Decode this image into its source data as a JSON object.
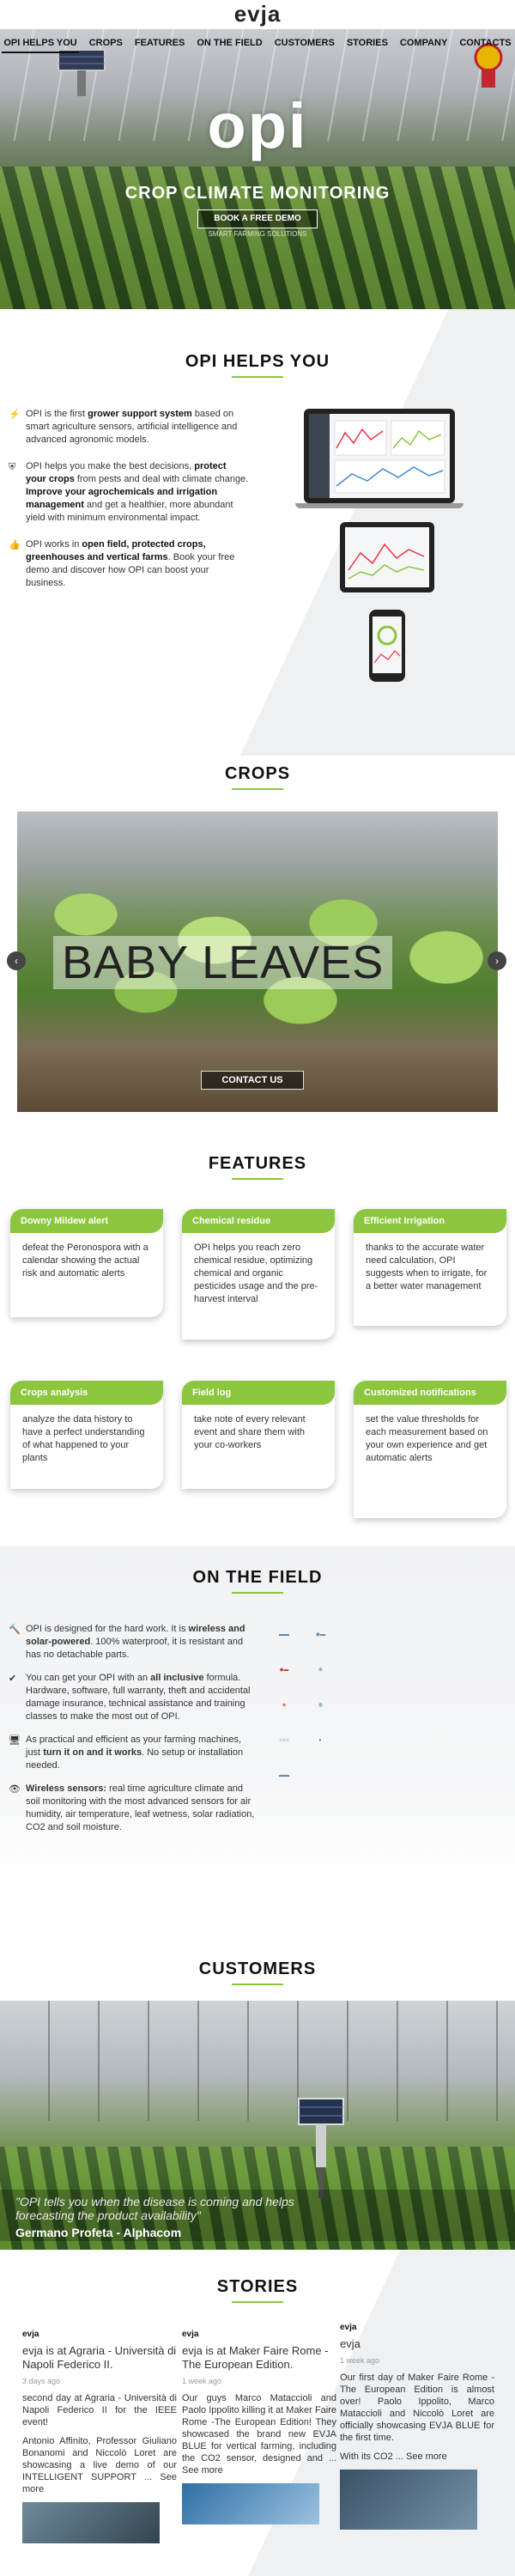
{
  "site": {
    "logo": "evja",
    "brand_mark": "opi"
  },
  "nav": [
    "OPI HELPS YOU",
    "CROPS",
    "FEATURES",
    "ON THE FIELD",
    "CUSTOMERS",
    "STORIES",
    "COMPANY",
    "CONTACTS"
  ],
  "hero": {
    "title": "CROP CLIMATE MONITORING",
    "cta": "BOOK A FREE DEMO",
    "tagline": "SMART FARMING SOLUTIONS"
  },
  "help": {
    "title": "OPI HELPS YOU",
    "items": [
      {
        "icon": "bolt-icon",
        "parts": [
          "OPI is the first ",
          "grower support system",
          " based on smart agriculture sensors, artificial intelligence and advanced agronomic models."
        ]
      },
      {
        "icon": "shield-icon",
        "parts": [
          "OPI helps you make the best decisions, ",
          "protect your crops",
          " from pests  and deal with climate change. ",
          "Improve your agrochemicals and irrigation management",
          " and get a healthier, more abundant yield with minimum environmental impact."
        ]
      },
      {
        "icon": "thumbs-up-icon",
        "parts": [
          "OPI works in ",
          "open field, protected crops, greenhouses and vertical farms",
          ". Book your free demo and discover how OPI can boost your business."
        ]
      }
    ]
  },
  "crops": {
    "title": "CROPS",
    "slide_label": "BABY LEAVES",
    "cta": "CONTACT US",
    "prev": "‹",
    "next": "›"
  },
  "features": {
    "title": "FEATURES",
    "cards": [
      {
        "title": "Downy Mildew alert",
        "text": "defeat the Peronospora with a calendar showing the actual risk and automatic alerts"
      },
      {
        "title": "Chemical residue",
        "text": "OPI helps you reach zero chemical residue, optimizing chemical and organic pesticides usage and the pre-harvest interval"
      },
      {
        "title": "Efficient Irrigation",
        "text": "thanks to the accurate water need calculation, OPI suggests when to irrigate, for a better water management"
      },
      {
        "title": "Crops analysis",
        "text": "analyze the data history to have a perfect understanding of what happened to your plants"
      },
      {
        "title": "Field log",
        "text": "take note of every relevant event and share them with your co-workers"
      },
      {
        "title": "Customized notifications",
        "text": "set the value thresholds for each measurement based on your own experience and get automatic alerts"
      }
    ]
  },
  "field": {
    "title": "ON THE FIELD",
    "items": [
      {
        "icon": "hammer-icon",
        "parts": [
          "OPI is designed for the hard work. It is ",
          "wireless and solar-powered",
          ". 100% waterproof, it is resistant and has no detachable parts."
        ]
      },
      {
        "icon": "check-icon",
        "parts": [
          "You can get your OPI with an ",
          "all inclusive",
          " formula. Hardware, software, full warranty, theft and accidental damage insurance, technical assistance and training classes to make the most out of  OPI."
        ]
      },
      {
        "icon": "monitor-icon",
        "parts": [
          "As practical and efficient as your farming machines, just ",
          "turn it on and it works",
          ". No setup or installation needed."
        ]
      },
      {
        "icon": "eye-icon",
        "parts": [
          "",
          "Wireless sensors:",
          " real time agriculture climate and soil monitoring with the most advanced sensors for air humidity, air temperature, leaf wetness, solar radiation, CO2 and soil moisture."
        ]
      }
    ],
    "partners": [
      "partner",
      "partner",
      "partner",
      "partner",
      "partner",
      "partner",
      "partner",
      "partner",
      "partner"
    ]
  },
  "customers": {
    "title": "CUSTOMERS",
    "quote": "\"OPI tells you when the disease is coming and helps forecasting the product availability\"",
    "name": "Germano Profeta - Alphacom"
  },
  "stories": {
    "title": "STORIES",
    "posts": [
      {
        "avatar": "evja",
        "head": "evja is at Agraria - Università di Napoli Federico II.",
        "time": "3 days ago",
        "p1": "second day at Agraria - Università di Napoli Federico II for the IEEE event!",
        "p2": "Antonio Affinito, Professor Giuliano Bonanomi and Niccolò Loret are showcasing a live demo of our INTELLIGENT SUPPORT ... See more"
      },
      {
        "avatar": "evja",
        "head": "evja is at Maker Faire Rome -The European Edition.",
        "time": "1 week ago",
        "p1": "Our guys Marco Mataccioli and Paolo Ippolito killing it at Maker Faire Rome -The European Edition! They showcased the brand new EVJA BLUE for vertical farming, including the CO2 sensor, designed and ... See more",
        "p2": ""
      },
      {
        "avatar": "evja",
        "head": "evja",
        "time": "1 week ago",
        "p1": "Our first day of Maker Faire Rome -The European Edition is almost over! Paolo Ippolito, Marco Mataccioli and Niccolò Loret are officially showcasing EVJA BLUE for the first time.",
        "p2": "With its CO2 ... See more"
      }
    ]
  },
  "colors": {
    "accent": "#8cc63f",
    "text": "#222222"
  }
}
